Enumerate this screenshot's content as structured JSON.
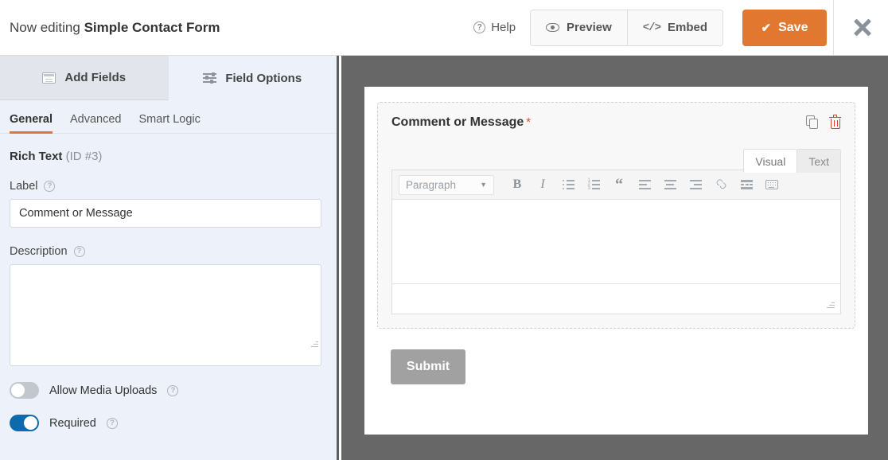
{
  "topbar": {
    "editing_prefix": "Now editing",
    "form_name": "Simple Contact Form",
    "help_label": "Help",
    "preview_label": "Preview",
    "embed_label": "Embed",
    "save_label": "Save",
    "accent_color": "#e27730"
  },
  "sidebar": {
    "panel_tabs": [
      {
        "label": "Add Fields",
        "icon": "fields-icon",
        "active": false
      },
      {
        "label": "Field Options",
        "icon": "sliders-icon",
        "active": true
      }
    ],
    "sub_tabs": [
      {
        "label": "General",
        "active": true
      },
      {
        "label": "Advanced",
        "active": false
      },
      {
        "label": "Smart Logic",
        "active": false
      }
    ],
    "field_type": "Rich Text",
    "field_id": "(ID #3)",
    "label_heading": "Label",
    "label_value": "Comment or Message",
    "description_heading": "Description",
    "description_value": "",
    "toggles": [
      {
        "label": "Allow Media Uploads",
        "on": false
      },
      {
        "label": "Required",
        "on": true
      }
    ],
    "toggle_on_color": "#0d6aad",
    "toggle_off_color": "#c2c7ce"
  },
  "preview": {
    "field_label": "Comment or Message",
    "required_marker": "*",
    "required_color": "#e24b3a",
    "editor_tabs": [
      {
        "label": "Visual",
        "active": true
      },
      {
        "label": "Text",
        "active": false
      }
    ],
    "toolbar": {
      "format_select": "Paragraph",
      "buttons": [
        "bold-icon",
        "italic-icon",
        "bulleted-list-icon",
        "numbered-list-icon",
        "blockquote-icon",
        "align-left-icon",
        "align-center-icon",
        "align-right-icon",
        "link-icon",
        "read-more-icon",
        "keyboard-shortcuts-icon"
      ]
    },
    "editor_content": "",
    "submit_label": "Submit",
    "actions": [
      {
        "name": "duplicate-field-icon"
      },
      {
        "name": "delete-field-icon"
      }
    ],
    "background_color": "#676767"
  }
}
